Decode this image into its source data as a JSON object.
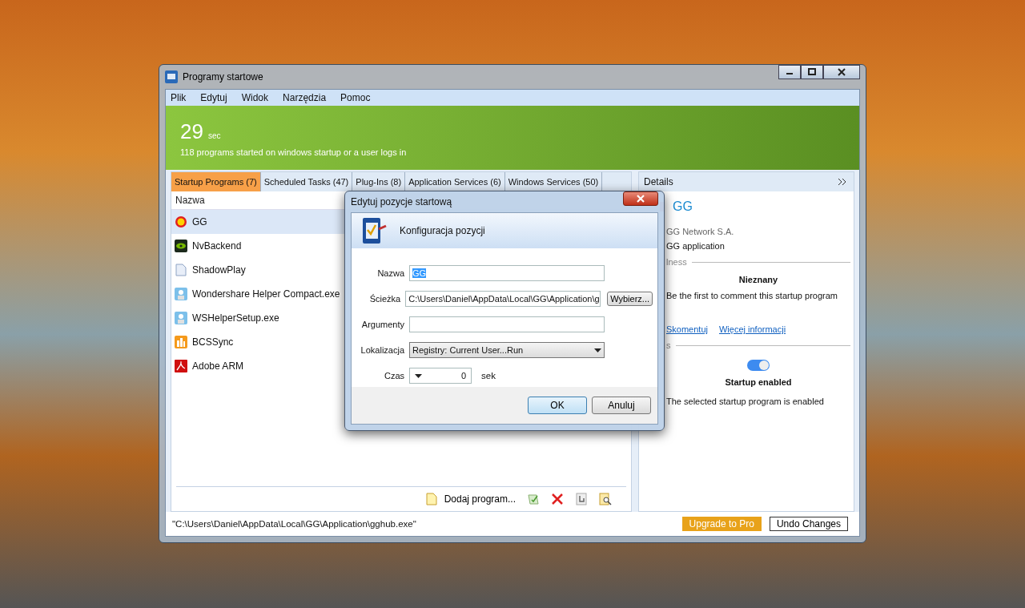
{
  "window": {
    "title": "Programy startowe"
  },
  "menu": [
    "Plik",
    "Edytuj",
    "Widok",
    "Narzędzia",
    "Pomoc"
  ],
  "banner": {
    "value": "29",
    "unit": "sec",
    "subtitle": "118 programs started on windows startup or a user logs in"
  },
  "tabs": [
    {
      "label": "Startup Programs (7)",
      "selected": true
    },
    {
      "label": "Scheduled Tasks (47)",
      "selected": false
    },
    {
      "label": "Plug-Ins (8)",
      "selected": false
    },
    {
      "label": "Application Services (6)",
      "selected": false
    },
    {
      "label": "Windows Services (50)",
      "selected": false
    }
  ],
  "list": {
    "columns": [
      "Nazwa"
    ],
    "rows": [
      {
        "name": "GG",
        "selected": true
      },
      {
        "name": "NvBackend",
        "selected": false
      },
      {
        "name": "ShadowPlay",
        "selected": false
      },
      {
        "name": "Wondershare Helper Compact.exe",
        "selected": false
      },
      {
        "name": "WSHelperSetup.exe",
        "selected": false
      },
      {
        "name": "BCSSync",
        "selected": false
      },
      {
        "name": "Adobe ARM",
        "selected": false
      }
    ]
  },
  "toolbar": {
    "add_label": "Dodaj program..."
  },
  "details": {
    "header": "Details",
    "title": "GG",
    "publisher": "GG Network S.A.",
    "description": "GG application",
    "rating_section": "lness",
    "rating": "Nieznany",
    "rating_text": "Be the first to comment this startup program",
    "links": [
      "Skomentuj",
      "Więcej informacji"
    ],
    "status_section": "s",
    "enabled": true,
    "status_title": "Startup enabled",
    "status_text": "The selected startup program is enabled"
  },
  "status_bar": {
    "path": "\"C:\\Users\\Daniel\\AppData\\Local\\GG\\Application\\gghub.exe\"",
    "buttons": [
      {
        "label": "Upgrade to Pro",
        "kind": "primary"
      },
      {
        "label": "Undo Changes",
        "kind": "secondary"
      }
    ]
  },
  "dialog": {
    "title": "Edytuj pozycje startową",
    "header": "Konfiguracja pozycji",
    "fields": [
      {
        "label": "Nazwa",
        "kind": "text",
        "value": "GG",
        "text_selected": true
      },
      {
        "label": "Ścieżka",
        "kind": "text",
        "value": "C:\\Users\\Daniel\\AppData\\Local\\GG\\Application\\g",
        "text_selected": false,
        "button": "Wybierz..."
      },
      {
        "label": "Argumenty",
        "kind": "text"
      },
      {
        "label": "Lokalizacja",
        "kind": "dropdown",
        "value": "Registry: Current User...Run"
      },
      {
        "label": "Czas",
        "kind": "spinner",
        "value": "0",
        "unit": "sek"
      }
    ],
    "buttons": [
      {
        "label": "OK",
        "default": true
      },
      {
        "label": "Anuluj",
        "default": false
      }
    ]
  }
}
